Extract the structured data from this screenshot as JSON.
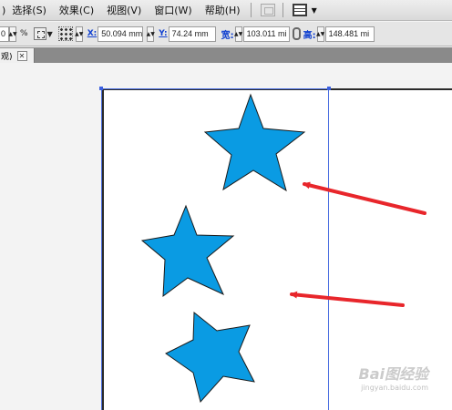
{
  "menu": {
    "fragment": ")",
    "items": [
      "选择(S)",
      "效果(C)",
      "视图(V)",
      "窗口(W)",
      "帮助(H)"
    ],
    "icons": [
      "bridge-icon",
      "layout-icon"
    ]
  },
  "control": {
    "zoom_value": "0",
    "percent": "%",
    "x_label": "X:",
    "x_value": "50.094 mm",
    "y_label": "Y:",
    "y_value": "74.24 mm",
    "width_label": "宽:",
    "width_value": "103.011 mi",
    "height_label": "高:",
    "height_value": "148.481 mi"
  },
  "tab": {
    "label": "观)",
    "close": "✕"
  },
  "colors": {
    "star_fill": "#0a9be3",
    "arrow": "#e8262b",
    "selection": "#4a6ee0"
  },
  "watermark": {
    "main": "Bai图经验",
    "sub": "jingyan.baidu.com"
  }
}
